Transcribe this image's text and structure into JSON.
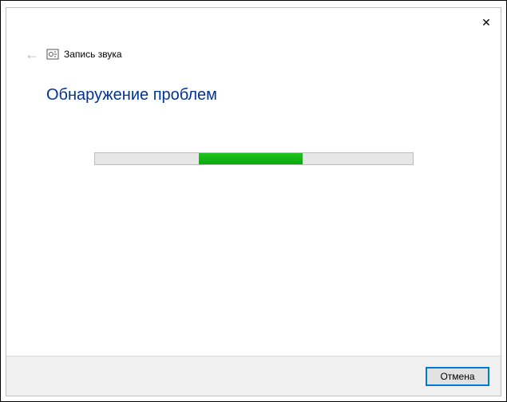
{
  "window": {
    "title": "Запись звука",
    "close_label": "✕"
  },
  "content": {
    "heading": "Обнаружение проблем"
  },
  "footer": {
    "cancel_label": "Отмена"
  }
}
